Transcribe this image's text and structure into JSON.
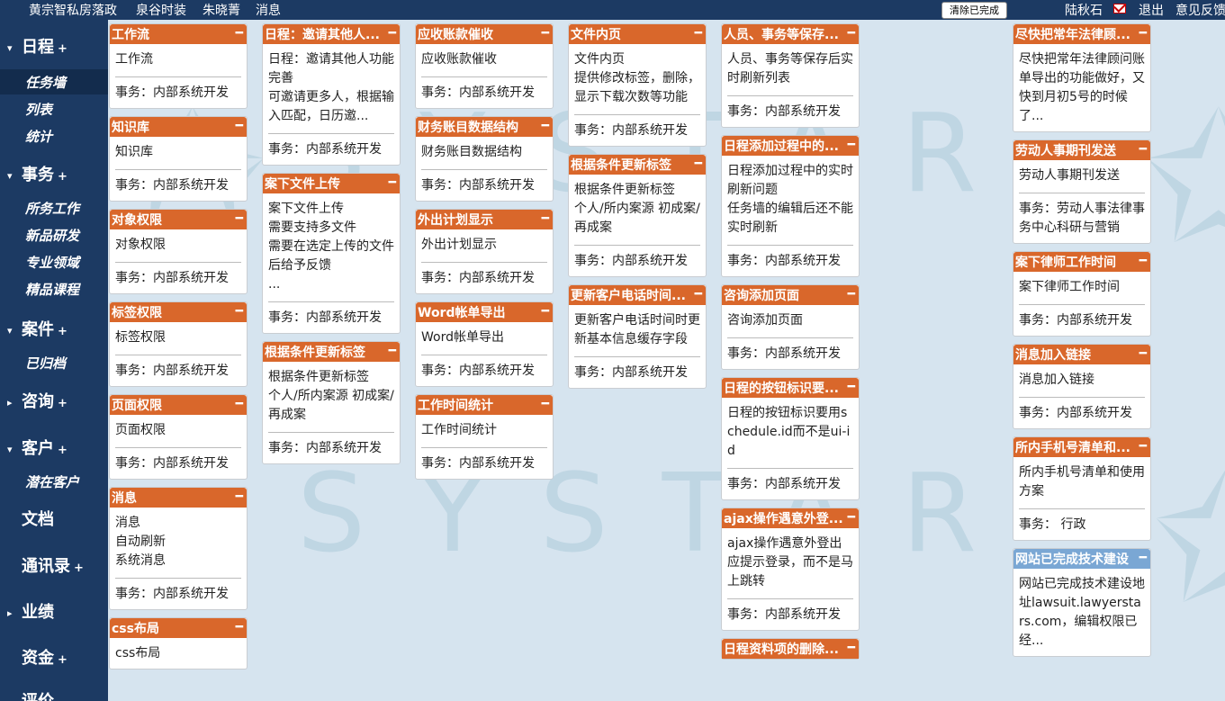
{
  "topbar": {
    "links": [
      "黄宗智私房落政",
      "泉谷时装",
      "朱晓菁",
      "消息"
    ],
    "clear_label": "清除已完成",
    "user": "陆秋石",
    "logout": "退出",
    "feedback": "意见反馈"
  },
  "sidebar": {
    "sections": [
      {
        "label": "日程",
        "items": [
          "任务墙",
          "列表",
          "统计"
        ]
      },
      {
        "label": "事务",
        "items": [
          "所务工作",
          "新品研发",
          "专业领域",
          "精品课程"
        ]
      },
      {
        "label": "案件",
        "items": [
          "已归档"
        ]
      },
      {
        "label": "咨询",
        "items": []
      },
      {
        "label": "客户",
        "items": [
          "潜在客户"
        ]
      },
      {
        "label": "文档",
        "items": []
      },
      {
        "label": "通讯录",
        "items": []
      },
      {
        "label": "业绩",
        "items": []
      },
      {
        "label": "资金",
        "items": []
      },
      {
        "label": "评价",
        "items": []
      }
    ]
  },
  "watermark": "SYSTAR",
  "columns": [
    [
      {
        "title": "工作流",
        "desc": "工作流",
        "meta": "事务：内部系统开发"
      },
      {
        "title": "知识库",
        "desc": "知识库",
        "meta": "事务：内部系统开发"
      },
      {
        "title": "对象权限",
        "desc": "对象权限",
        "meta": "事务：内部系统开发"
      },
      {
        "title": "标签权限",
        "desc": "标签权限",
        "meta": "事务：内部系统开发"
      },
      {
        "title": "页面权限",
        "desc": "页面权限",
        "meta": "事务：内部系统开发"
      },
      {
        "title": "消息",
        "desc": "消息\n自动刷新\n系统消息",
        "meta": "事务：内部系统开发"
      },
      {
        "title": "css布局",
        "desc": "css布局",
        "meta": ""
      }
    ],
    [
      {
        "title": "日程：邀请其他人...",
        "desc": "日程：邀请其他人功能完善\n可邀请更多人，根据输入匹配，日历邀...",
        "meta": "事务：内部系统开发"
      },
      {
        "title": "案下文件上传",
        "desc": "案下文件上传\n需要支持多文件\n需要在选定上传的文件后给予反馈\n...",
        "meta": "事务：内部系统开发"
      },
      {
        "title": "根据条件更新标签",
        "desc": "根据条件更新标签\n个人/所内案源 初成案/再成案",
        "meta": "事务：内部系统开发"
      }
    ],
    [
      {
        "title": "应收账款催收",
        "desc": "应收账款催收",
        "meta": "事务：内部系统开发"
      },
      {
        "title": "财务账目数据结构",
        "desc": "财务账目数据结构",
        "meta": "事务：内部系统开发"
      },
      {
        "title": "外出计划显示",
        "desc": "外出计划显示",
        "meta": "事务：内部系统开发"
      },
      {
        "title": "Word帐单导出",
        "desc": "Word帐单导出",
        "meta": "事务：内部系统开发"
      },
      {
        "title": "工作时间统计",
        "desc": "工作时间统计",
        "meta": "事务：内部系统开发"
      }
    ],
    [
      {
        "title": "文件内页",
        "desc": "文件内页\n提供修改标签，删除，显示下载次数等功能",
        "meta": "事务：内部系统开发"
      },
      {
        "title": "根据条件更新标签",
        "desc": "根据条件更新标签\n个人/所内案源 初成案/再成案",
        "meta": "事务：内部系统开发"
      },
      {
        "title": "更新客户电话时间...",
        "desc": "更新客户电话时间时更新基本信息缓存字段",
        "meta": "事务：内部系统开发"
      }
    ],
    [
      {
        "title": "人员、事务等保存...",
        "desc": "人员、事务等保存后实时刷新列表",
        "meta": "事务：内部系统开发"
      },
      {
        "title": "日程添加过程中的...",
        "desc": "日程添加过程中的实时刷新问题\n任务墙的编辑后还不能实时刷新",
        "meta": "事务：内部系统开发"
      },
      {
        "title": "咨询添加页面",
        "desc": "咨询添加页面",
        "meta": "事务：内部系统开发"
      },
      {
        "title": "日程的按钮标识要...",
        "desc": "日程的按钮标识要用schedule.id而不是ui-id",
        "meta": "事务：内部系统开发"
      },
      {
        "title": "ajax操作遇意外登...",
        "desc": "ajax操作遇意外登出应提示登录，而不是马上跳转",
        "meta": "事务：内部系统开发"
      },
      {
        "title": "日程资料项的删除...",
        "desc": "",
        "meta": ""
      }
    ],
    [],
    [
      {
        "title": "尽快把常年法律顾...",
        "desc": "尽快把常年法律顾问账单导出的功能做好，又快到月初5号的时候了...",
        "meta": ""
      },
      {
        "title": "劳动人事期刊发送",
        "desc": "劳动人事期刊发送",
        "meta": "事务：劳动人事法律事务中心科研与营销"
      },
      {
        "title": "案下律师工作时间",
        "desc": "案下律师工作时间",
        "meta": "事务：内部系统开发"
      },
      {
        "title": "消息加入链接",
        "desc": "消息加入链接",
        "meta": "事务：内部系统开发"
      },
      {
        "title": "所内手机号清单和...",
        "desc": "所内手机号清单和使用方案",
        "meta": "事务： 行政"
      },
      {
        "title": "网站已完成技术建设",
        "desc": "网站已完成技术建设地址lawsuit.lawyerstars.com，编辑权限已经...",
        "meta": "",
        "blue": "true"
      }
    ]
  ]
}
